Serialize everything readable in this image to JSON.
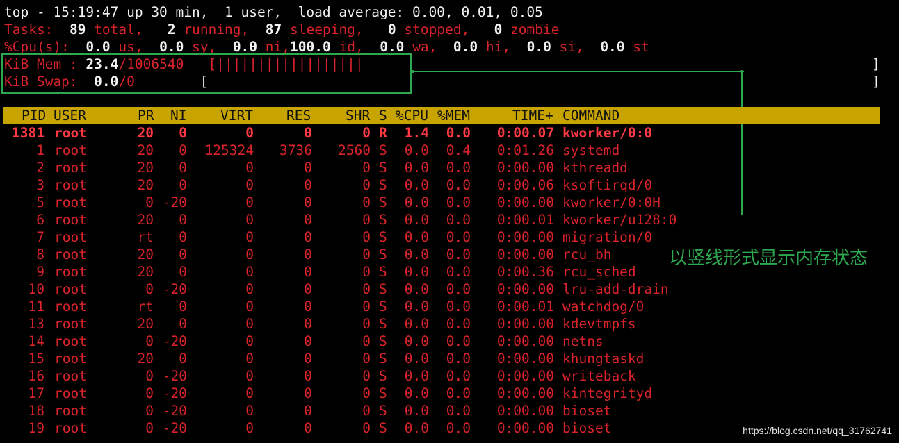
{
  "summary": {
    "line1": "top - 15:19:47 up 30 min,  1 user,  load average: 0.00, 0.01, 0.05",
    "tasks_label": "Tasks:",
    "tasks_total": "89",
    "total_label": "total,",
    "tasks_running": "2",
    "running_label": "running,",
    "tasks_sleeping": "87",
    "sleeping_label": "sleeping,",
    "tasks_stopped": "0",
    "stopped_label": "stopped,",
    "tasks_zombie": "0",
    "zombie_label": "zombie",
    "cpu_label": "%Cpu(s):",
    "cpu_us": "0.0",
    "us_label": "us,",
    "cpu_sy": "0.0",
    "sy_label": "sy,",
    "cpu_ni": "0.0",
    "ni_label": "ni,",
    "cpu_id": "100.0",
    "id_label": "id,",
    "cpu_wa": "0.0",
    "wa_label": "wa,",
    "cpu_hi": "0.0",
    "hi_label": "hi,",
    "cpu_si": "0.0",
    "si_label": "si,",
    "cpu_st": "0.0",
    "st_label": "st"
  },
  "memory": {
    "mem_label": "KiB Mem :",
    "mem_used_pct": "23.4",
    "mem_total": "/1006540",
    "mem_bar": "[||||||||||||||||||",
    "swap_label": "KiB Swap:",
    "swap_used": "0.0",
    "swap_total": "/0",
    "swap_bar": "[",
    "bracket_close": "]"
  },
  "header": {
    "pid": "PID",
    "user": "USER",
    "pr": "PR",
    "ni": "NI",
    "virt": "VIRT",
    "res": "RES",
    "shr": "SHR",
    "s": "S",
    "cpu": "%CPU",
    "mem": "%MEM",
    "time": "TIME+",
    "command": "COMMAND"
  },
  "processes": [
    {
      "pid": "1381",
      "user": "root",
      "pr": "20",
      "ni": "0",
      "virt": "0",
      "res": "0",
      "shr": "0",
      "s": "R",
      "cpu": "1.4",
      "mem": "0.0",
      "time": "0:00.07",
      "command": "kworker/0:0"
    },
    {
      "pid": "1",
      "user": "root",
      "pr": "20",
      "ni": "0",
      "virt": "125324",
      "res": "3736",
      "shr": "2560",
      "s": "S",
      "cpu": "0.0",
      "mem": "0.4",
      "time": "0:01.26",
      "command": "systemd"
    },
    {
      "pid": "2",
      "user": "root",
      "pr": "20",
      "ni": "0",
      "virt": "0",
      "res": "0",
      "shr": "0",
      "s": "S",
      "cpu": "0.0",
      "mem": "0.0",
      "time": "0:00.00",
      "command": "kthreadd"
    },
    {
      "pid": "3",
      "user": "root",
      "pr": "20",
      "ni": "0",
      "virt": "0",
      "res": "0",
      "shr": "0",
      "s": "S",
      "cpu": "0.0",
      "mem": "0.0",
      "time": "0:00.06",
      "command": "ksoftirqd/0"
    },
    {
      "pid": "5",
      "user": "root",
      "pr": "0",
      "ni": "-20",
      "virt": "0",
      "res": "0",
      "shr": "0",
      "s": "S",
      "cpu": "0.0",
      "mem": "0.0",
      "time": "0:00.00",
      "command": "kworker/0:0H"
    },
    {
      "pid": "6",
      "user": "root",
      "pr": "20",
      "ni": "0",
      "virt": "0",
      "res": "0",
      "shr": "0",
      "s": "S",
      "cpu": "0.0",
      "mem": "0.0",
      "time": "0:00.01",
      "command": "kworker/u128:0"
    },
    {
      "pid": "7",
      "user": "root",
      "pr": "rt",
      "ni": "0",
      "virt": "0",
      "res": "0",
      "shr": "0",
      "s": "S",
      "cpu": "0.0",
      "mem": "0.0",
      "time": "0:00.00",
      "command": "migration/0"
    },
    {
      "pid": "8",
      "user": "root",
      "pr": "20",
      "ni": "0",
      "virt": "0",
      "res": "0",
      "shr": "0",
      "s": "S",
      "cpu": "0.0",
      "mem": "0.0",
      "time": "0:00.00",
      "command": "rcu_bh"
    },
    {
      "pid": "9",
      "user": "root",
      "pr": "20",
      "ni": "0",
      "virt": "0",
      "res": "0",
      "shr": "0",
      "s": "S",
      "cpu": "0.0",
      "mem": "0.0",
      "time": "0:00.36",
      "command": "rcu_sched"
    },
    {
      "pid": "10",
      "user": "root",
      "pr": "0",
      "ni": "-20",
      "virt": "0",
      "res": "0",
      "shr": "0",
      "s": "S",
      "cpu": "0.0",
      "mem": "0.0",
      "time": "0:00.00",
      "command": "lru-add-drain"
    },
    {
      "pid": "11",
      "user": "root",
      "pr": "rt",
      "ni": "0",
      "virt": "0",
      "res": "0",
      "shr": "0",
      "s": "S",
      "cpu": "0.0",
      "mem": "0.0",
      "time": "0:00.01",
      "command": "watchdog/0"
    },
    {
      "pid": "13",
      "user": "root",
      "pr": "20",
      "ni": "0",
      "virt": "0",
      "res": "0",
      "shr": "0",
      "s": "S",
      "cpu": "0.0",
      "mem": "0.0",
      "time": "0:00.00",
      "command": "kdevtmpfs"
    },
    {
      "pid": "14",
      "user": "root",
      "pr": "0",
      "ni": "-20",
      "virt": "0",
      "res": "0",
      "shr": "0",
      "s": "S",
      "cpu": "0.0",
      "mem": "0.0",
      "time": "0:00.00",
      "command": "netns"
    },
    {
      "pid": "15",
      "user": "root",
      "pr": "20",
      "ni": "0",
      "virt": "0",
      "res": "0",
      "shr": "0",
      "s": "S",
      "cpu": "0.0",
      "mem": "0.0",
      "time": "0:00.00",
      "command": "khungtaskd"
    },
    {
      "pid": "16",
      "user": "root",
      "pr": "0",
      "ni": "-20",
      "virt": "0",
      "res": "0",
      "shr": "0",
      "s": "S",
      "cpu": "0.0",
      "mem": "0.0",
      "time": "0:00.00",
      "command": "writeback"
    },
    {
      "pid": "17",
      "user": "root",
      "pr": "0",
      "ni": "-20",
      "virt": "0",
      "res": "0",
      "shr": "0",
      "s": "S",
      "cpu": "0.0",
      "mem": "0.0",
      "time": "0:00.00",
      "command": "kintegrityd"
    },
    {
      "pid": "18",
      "user": "root",
      "pr": "0",
      "ni": "-20",
      "virt": "0",
      "res": "0",
      "shr": "0",
      "s": "S",
      "cpu": "0.0",
      "mem": "0.0",
      "time": "0:00.00",
      "command": "bioset"
    },
    {
      "pid": "19",
      "user": "root",
      "pr": "0",
      "ni": "-20",
      "virt": "0",
      "res": "0",
      "shr": "0",
      "s": "S",
      "cpu": "0.0",
      "mem": "0.0",
      "time": "0:00.00",
      "command": "bioset"
    }
  ],
  "annotation": {
    "text": "以竖线形式显示内存状态"
  },
  "watermark": "https://blog.csdn.net/qq_31762741",
  "colors": {
    "background": "#000000",
    "header_bar": "#c8a400",
    "process_text": "#d8232a",
    "annotation": "#2ea84f"
  }
}
